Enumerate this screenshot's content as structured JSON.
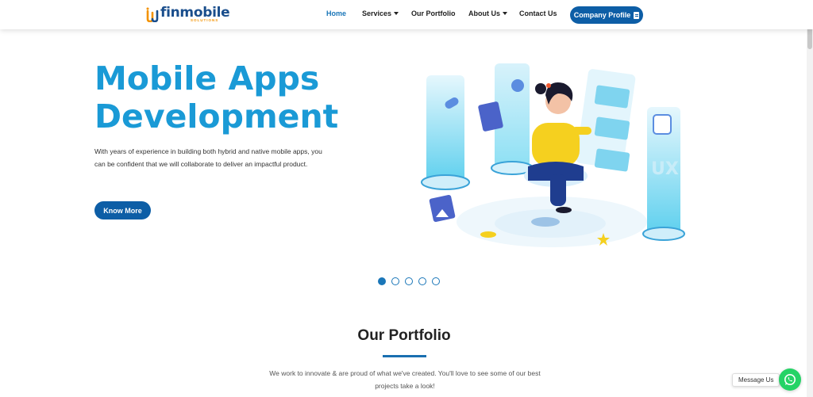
{
  "brand": {
    "name": "finmobile",
    "sub": "SOLUTIONS"
  },
  "nav": {
    "home": "Home",
    "services": "Services",
    "portfolio": "Our Portfolio",
    "about": "About Us",
    "contact": "Contact Us",
    "profile_button": "Company Profile"
  },
  "hero": {
    "title_line1": "Mobile Apps",
    "title_line2": "Development",
    "description": "With years of experience in building both hybrid and native mobile apps, you can be confident that we will collaborate to deliver an impactful product.",
    "cta": "Know More",
    "slides_total": 5,
    "active_slide": 1
  },
  "portfolio": {
    "title": "Our Portfolio",
    "subtitle": "We work to innovate & are proud of what we've created. You'll love to see some of our best projects take a look!"
  },
  "chat": {
    "label": "Message Us",
    "icon": "whatsapp-icon"
  },
  "colors": {
    "primary": "#0d5ea6",
    "accent": "#1a9ad6",
    "whatsapp": "#25d366",
    "logo_orange": "#f39200"
  }
}
